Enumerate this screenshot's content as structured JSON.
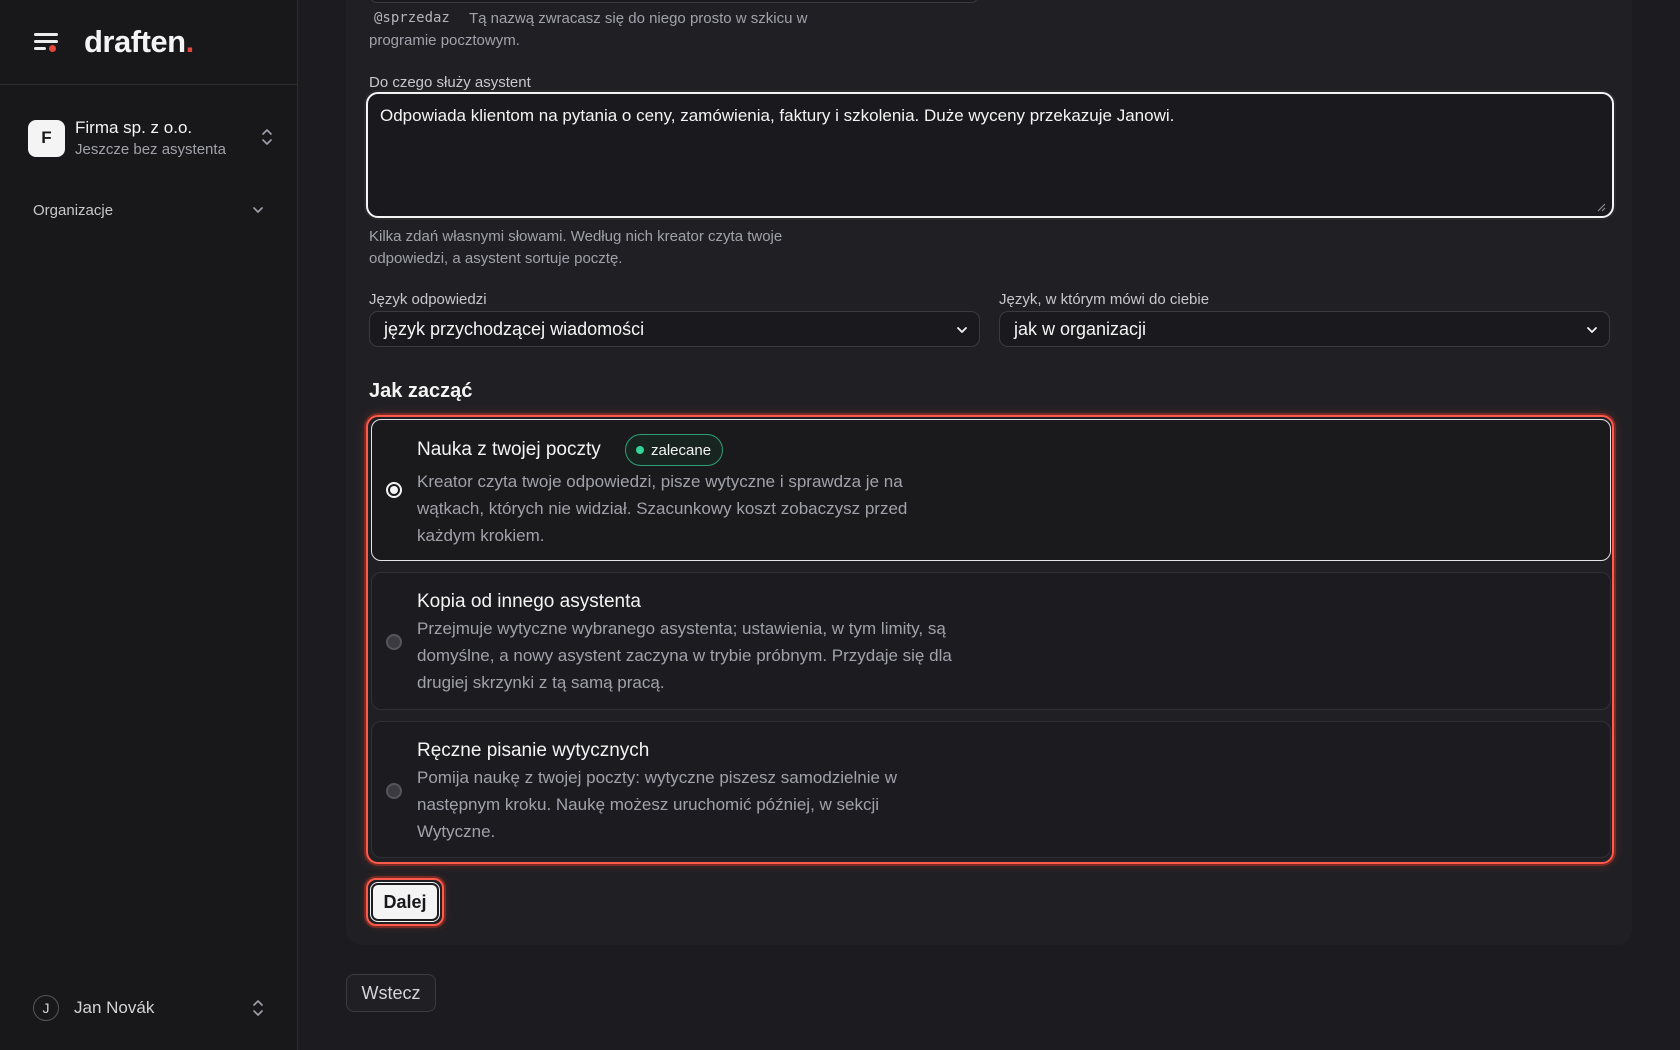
{
  "app": {
    "logo_text": "draften",
    "logo_dot": "."
  },
  "sidebar": {
    "org": {
      "initial": "F",
      "name": "Firma sp. z o.o.",
      "subtitle": "Jeszcze bez asystenta"
    },
    "nav": [
      {
        "label": "Organizacje"
      }
    ],
    "user": {
      "initial": "J",
      "name": "Jan Novák"
    }
  },
  "form": {
    "handle": {
      "value": "@sprzedaz",
      "hint": "Tą nazwą zwracasz się do niego prosto w szkicu w programie pocztowym."
    },
    "purpose": {
      "label": "Do czego służy asystent",
      "value": "Odpowiada klientom na pytania o ceny, zamówienia, faktury i szkolenia. Duże wyceny przekazuje Janowi.",
      "hint_line1": "Kilka zdań własnymi słowami. Według nich kreator czyta twoje",
      "hint_line2": "odpowiedzi, a asystent sortuje pocztę."
    },
    "reply_language": {
      "label": "Język odpowiedzi",
      "selected": "język przychodzącej wiadomości"
    },
    "ui_language": {
      "label": "Język, w którym mówi do ciebie",
      "selected": "jak w organizacji"
    },
    "start": {
      "title": "Jak zacząć",
      "options": [
        {
          "title": "Nauka z twojej poczty",
          "badge": "zalecane",
          "desc_lines": [
            "Kreator czyta twoje odpowiedzi, pisze wytyczne i sprawdza je na",
            "wątkach, których nie widział. Szacunkowy koszt zobaczysz przed",
            "każdym krokiem."
          ],
          "selected": true
        },
        {
          "title": "Kopia od innego asystenta",
          "desc_lines": [
            "Przejmuje wytyczne wybranego asystenta; ustawienia, w tym limity, są",
            "domyślne, a nowy asystent zaczyna w trybie próbnym. Przydaje się dla",
            "drugiej skrzynki z tą samą pracą."
          ],
          "selected": false
        },
        {
          "title": "Ręczne pisanie wytycznych",
          "desc_lines": [
            "Pomija naukę z twojej poczty: wytyczne piszesz samodzielnie w",
            "następnym kroku. Naukę możesz uruchomić później, w sekcji",
            "Wytyczne."
          ],
          "selected": false
        }
      ]
    },
    "next_label": "Dalej",
    "back_label": "Wstecz"
  },
  "colors": {
    "accent": "#e5483b",
    "badge": "#34d399",
    "background": "#1c1c20"
  }
}
